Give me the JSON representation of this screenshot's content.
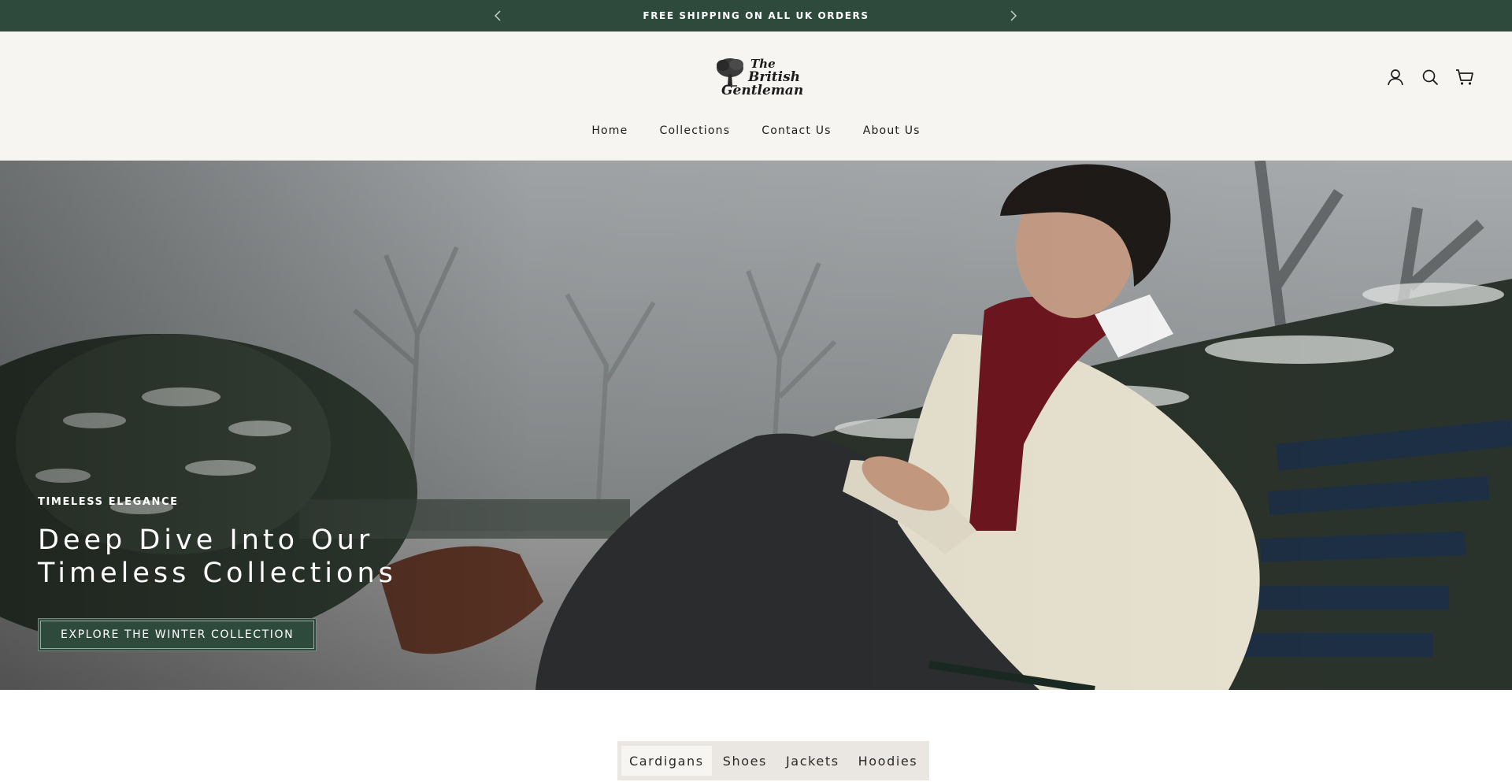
{
  "announcement": {
    "text": "FREE SHIPPING ON ALL UK ORDERS",
    "prev_icon": "chevron-left-icon",
    "next_icon": "chevron-right-icon"
  },
  "brand": {
    "logo_line1": "The",
    "logo_line2": "British",
    "logo_line3": "Gentleman",
    "logo_icon": "oak-tree-icon"
  },
  "header_icons": [
    "account-icon",
    "search-icon",
    "cart-icon"
  ],
  "nav": {
    "items": [
      {
        "label": "Home"
      },
      {
        "label": "Collections"
      },
      {
        "label": "Contact Us"
      },
      {
        "label": "About Us"
      }
    ]
  },
  "hero": {
    "eyebrow": "TIMELESS ELEGANCE",
    "title": "Deep Dive Into Our Timeless Collections",
    "button_label": "EXPLORE THE WINTER COLLECTION"
  },
  "tabs": {
    "items": [
      {
        "label": "Cardigans",
        "active": true
      },
      {
        "label": "Shoes",
        "active": false
      },
      {
        "label": "Jackets",
        "active": false
      },
      {
        "label": "Hoodies",
        "active": false
      }
    ]
  },
  "colors": {
    "brand_green": "#2e4a3c",
    "header_bg": "#f7f5f1",
    "tab_bar_bg": "#eae6e1"
  }
}
